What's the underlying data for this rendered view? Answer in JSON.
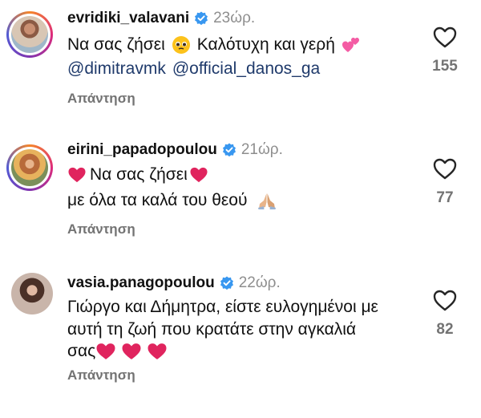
{
  "comments": [
    {
      "username": "evridiki_valavani",
      "time": "23ώρ.",
      "line1_a": "Να σας ζήσει",
      "line1_b": "Καλότυχη και γερή",
      "line2_mention1": "@dimitravmk",
      "line2_mention2": "@official_danos_ga",
      "reply": "Απάντηση",
      "likes": "155",
      "avatar_story": true
    },
    {
      "username": "eirini_papadopoulou",
      "time": "21ώρ.",
      "line1": "Να σας ζήσει",
      "line2": "με όλα τα καλά του θεού",
      "reply": "Απάντηση",
      "likes": "77",
      "avatar_story": true
    },
    {
      "username": "vasia.panagopoulou",
      "time": "22ώρ.",
      "line1": "Γιώργο και Δήμητρα, είστε ευλογημένοι με",
      "line2": "αυτή τη ζωή που κρατάτε στην αγκαλιά",
      "line3": "σας",
      "reply": "Απάντηση",
      "likes": "82",
      "avatar_story": false
    }
  ],
  "icons": {
    "verified": "verified-badge-icon",
    "like": "heart-outline-icon",
    "emoji_face": "pleading-face-icon",
    "emoji_hearts": "two-hearts-icon",
    "emoji_red_heart": "red-heart-icon",
    "emoji_pray": "folded-hands-icon"
  },
  "colors": {
    "verified": "#3897f0",
    "mention": "#1f3a6b",
    "muted": "#737373",
    "heart": "#e0245e"
  }
}
